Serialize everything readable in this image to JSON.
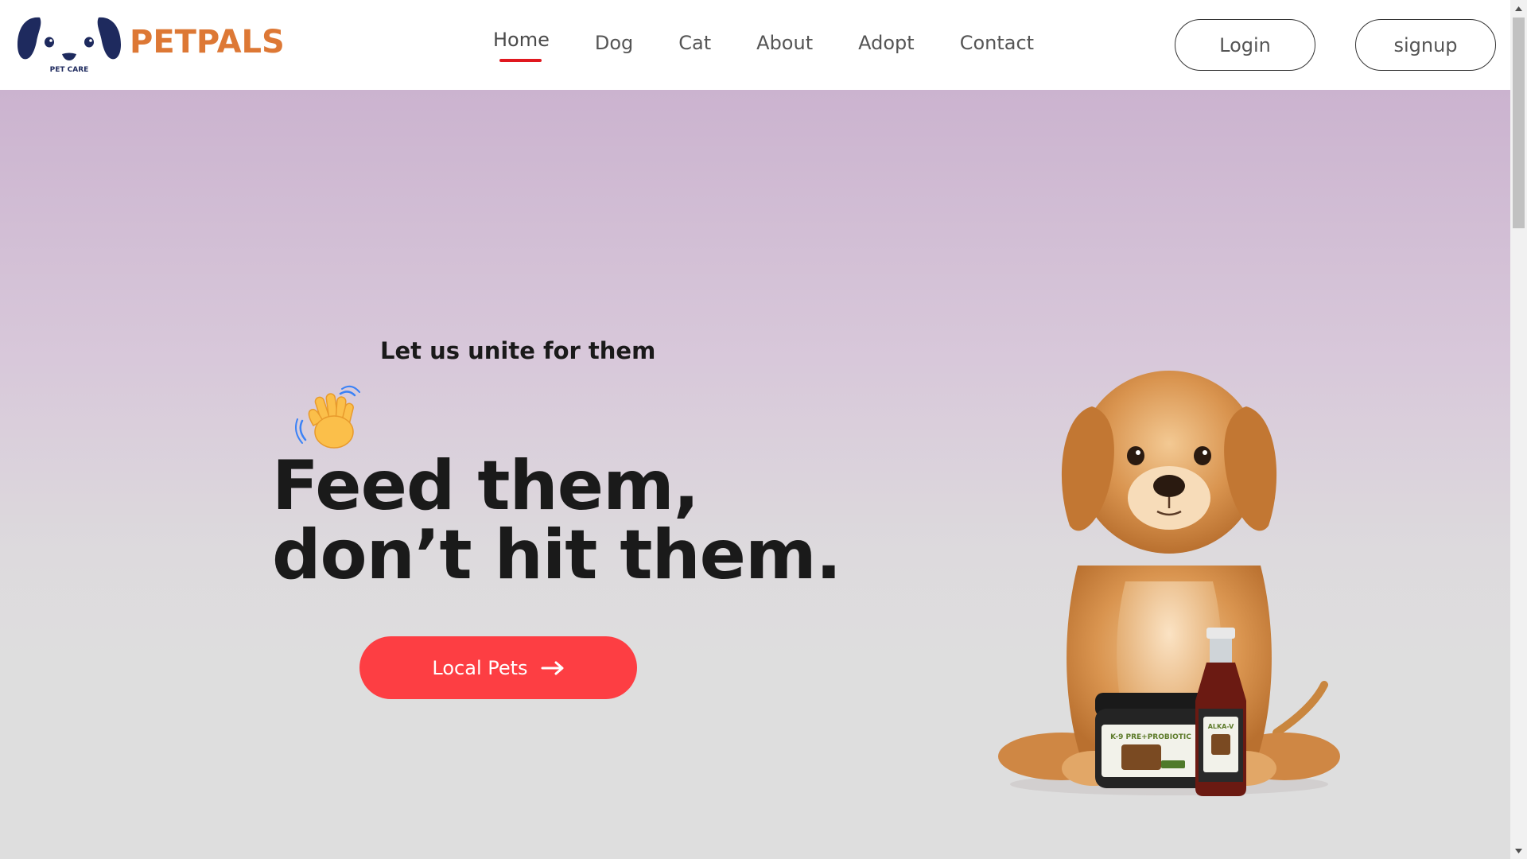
{
  "header": {
    "logo_icon": "dog-face-logo",
    "logo_caption": "PET CARE",
    "brand": "PETPALS",
    "brand_color": "#dd7835",
    "nav": [
      {
        "label": "Home",
        "active": true
      },
      {
        "label": "Dog",
        "active": false
      },
      {
        "label": "Cat",
        "active": false
      },
      {
        "label": "About",
        "active": false
      },
      {
        "label": "Adopt",
        "active": false
      },
      {
        "label": "Contact",
        "active": false
      }
    ],
    "active_indicator_color": "#e0181f",
    "login_label": "Login",
    "signup_label": "signup"
  },
  "hero": {
    "tagline": "Let us unite for them",
    "wave_icon": "waving-hand-emoji",
    "headline_line1": "Feed them,",
    "headline_line2": "don’t hit them.",
    "cta_label": "Local Pets",
    "cta_icon": "arrow-right-icon",
    "cta_color": "#fd3e43",
    "image": "puppy-with-supplement-products",
    "product_jar_text": "K-9 PRE+PROBIOTIC",
    "product_bottle_text": "ALKA-V"
  },
  "scrollbar": {
    "up_icon": "scroll-up-arrow-icon",
    "down_icon": "scroll-down-arrow-icon"
  }
}
